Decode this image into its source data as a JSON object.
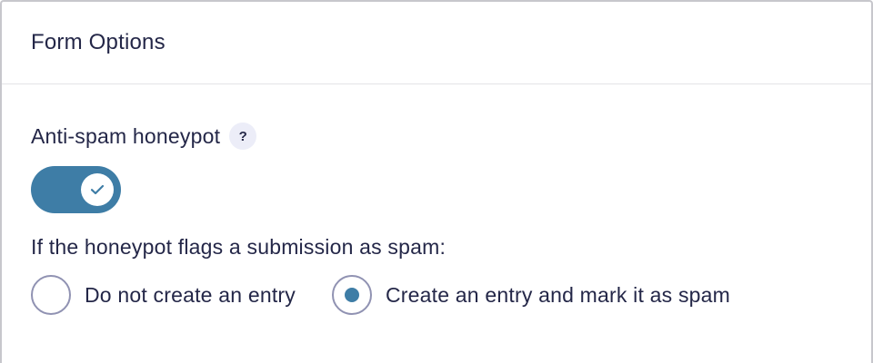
{
  "panel": {
    "title": "Form Options"
  },
  "honeypot": {
    "label": "Anti-spam honeypot",
    "help_symbol": "?",
    "toggle_enabled": true,
    "toggle_color": "#3e7da6"
  },
  "spam_action": {
    "label": "If the honeypot flags a submission as spam:",
    "options": [
      {
        "label": "Do not create an entry",
        "selected": false
      },
      {
        "label": "Create an entry and mark it as spam",
        "selected": true
      }
    ]
  },
  "colors": {
    "accent": "#3e7da6",
    "text": "#242748",
    "help_badge_bg": "#ecedf8",
    "radio_border": "#9092b2"
  }
}
